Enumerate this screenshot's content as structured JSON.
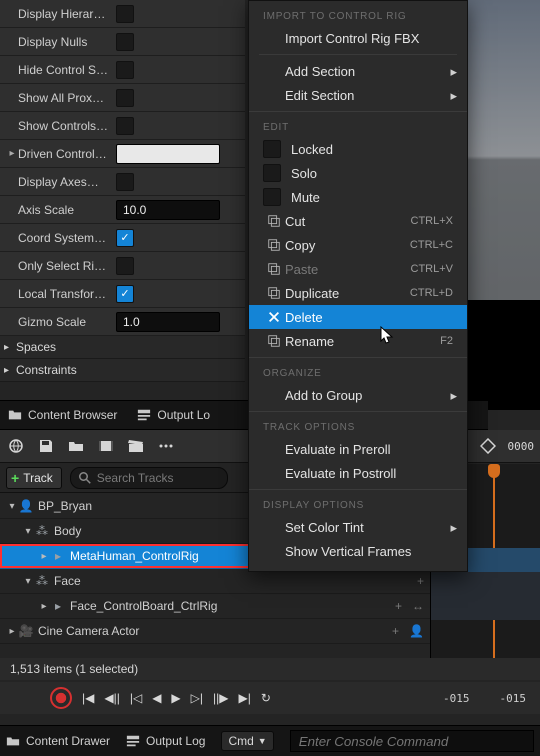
{
  "details": {
    "rows": [
      {
        "label": "Display Hierar…",
        "type": "check",
        "checked": false,
        "sub": false
      },
      {
        "label": "Display Nulls",
        "type": "check",
        "checked": false,
        "sub": false
      },
      {
        "label": "Hide Control S…",
        "type": "check",
        "checked": false,
        "sub": false
      },
      {
        "label": "Show All Prox…",
        "type": "check",
        "checked": false,
        "sub": false
      },
      {
        "label": "Show Controls…",
        "type": "check",
        "checked": false,
        "sub": false
      },
      {
        "label": "Driven Control…",
        "type": "whitebox",
        "sub": true
      },
      {
        "label": "Display Axes…",
        "type": "check",
        "checked": false,
        "sub": false
      },
      {
        "label": "Axis Scale",
        "type": "num",
        "value": "10.0",
        "sub": false
      },
      {
        "label": "Coord System…",
        "type": "check",
        "checked": true,
        "sub": false
      },
      {
        "label": "Only Select Ri…",
        "type": "check",
        "checked": false,
        "sub": false
      },
      {
        "label": "Local Transfor…",
        "type": "check",
        "checked": true,
        "sub": false
      },
      {
        "label": "Gizmo Scale",
        "type": "num",
        "value": "1.0",
        "sub": false
      }
    ],
    "sections": [
      {
        "label": "Spaces"
      },
      {
        "label": "Constraints"
      }
    ]
  },
  "tabs": {
    "content_browser": "Content Browser",
    "output_log": "Output Lo"
  },
  "seq": {
    "time": "0000",
    "add_track": "Track",
    "search_placeholder": "Search Tracks"
  },
  "tree": {
    "items": [
      {
        "label": "BP_Bryan",
        "indent": 0,
        "icon": "actor",
        "expand": "down"
      },
      {
        "label": "Body",
        "indent": 1,
        "icon": "bone",
        "expand": "down",
        "plus": true
      },
      {
        "label": "MetaHuman_ControlRig",
        "indent": 2,
        "icon": "rig",
        "expand": "right",
        "selected": true,
        "highlight": true,
        "plus": true,
        "dots": true
      },
      {
        "label": "Face",
        "indent": 1,
        "icon": "bone",
        "expand": "down",
        "plus": true
      },
      {
        "label": "Face_ControlBoard_CtrlRig",
        "indent": 2,
        "icon": "rig",
        "expand": "right",
        "plus": true,
        "dots": true
      },
      {
        "label": "Cine Camera Actor",
        "indent": 0,
        "icon": "camera",
        "expand": "right",
        "plus": true,
        "person": true
      }
    ]
  },
  "status": {
    "text": "1,513 items (1 selected)"
  },
  "transport": {
    "left_time": "-015",
    "right_time": "-015"
  },
  "bottom": {
    "content_drawer": "Content Drawer",
    "output_log": "Output Log",
    "cmd_label": "Cmd",
    "cmd_placeholder": "Enter Console Command"
  },
  "ctx": {
    "groups": [
      {
        "header": "IMPORT TO CONTROL RIG",
        "items": [
          {
            "label": "Import Control Rig FBX"
          }
        ]
      },
      {
        "sep": true,
        "items": [
          {
            "label": "Add Section",
            "submenu": true
          },
          {
            "label": "Edit Section",
            "submenu": true
          }
        ]
      },
      {
        "header": "EDIT",
        "items": [
          {
            "label": "Locked",
            "checkbox": true
          },
          {
            "label": "Solo",
            "checkbox": true
          },
          {
            "label": "Mute",
            "checkbox": true
          },
          {
            "label": "Cut",
            "icon": "cut",
            "hint": "CTRL+X"
          },
          {
            "label": "Copy",
            "icon": "copy",
            "hint": "CTRL+C"
          },
          {
            "label": "Paste",
            "icon": "paste",
            "hint": "CTRL+V",
            "disabled": true
          },
          {
            "label": "Duplicate",
            "icon": "dup",
            "hint": "CTRL+D"
          },
          {
            "label": "Delete",
            "icon": "del",
            "hover": true
          },
          {
            "label": "Rename",
            "icon": "ren",
            "hint": "F2"
          }
        ]
      },
      {
        "header": "ORGANIZE",
        "items": [
          {
            "label": "Add to Group",
            "submenu": true
          }
        ]
      },
      {
        "header": "TRACK OPTIONS",
        "items": [
          {
            "label": "Evaluate in Preroll"
          },
          {
            "label": "Evaluate in Postroll"
          }
        ]
      },
      {
        "header": "DISPLAY OPTIONS",
        "items": [
          {
            "label": "Set Color Tint",
            "submenu": true
          },
          {
            "label": "Show Vertical Frames"
          }
        ]
      }
    ]
  }
}
